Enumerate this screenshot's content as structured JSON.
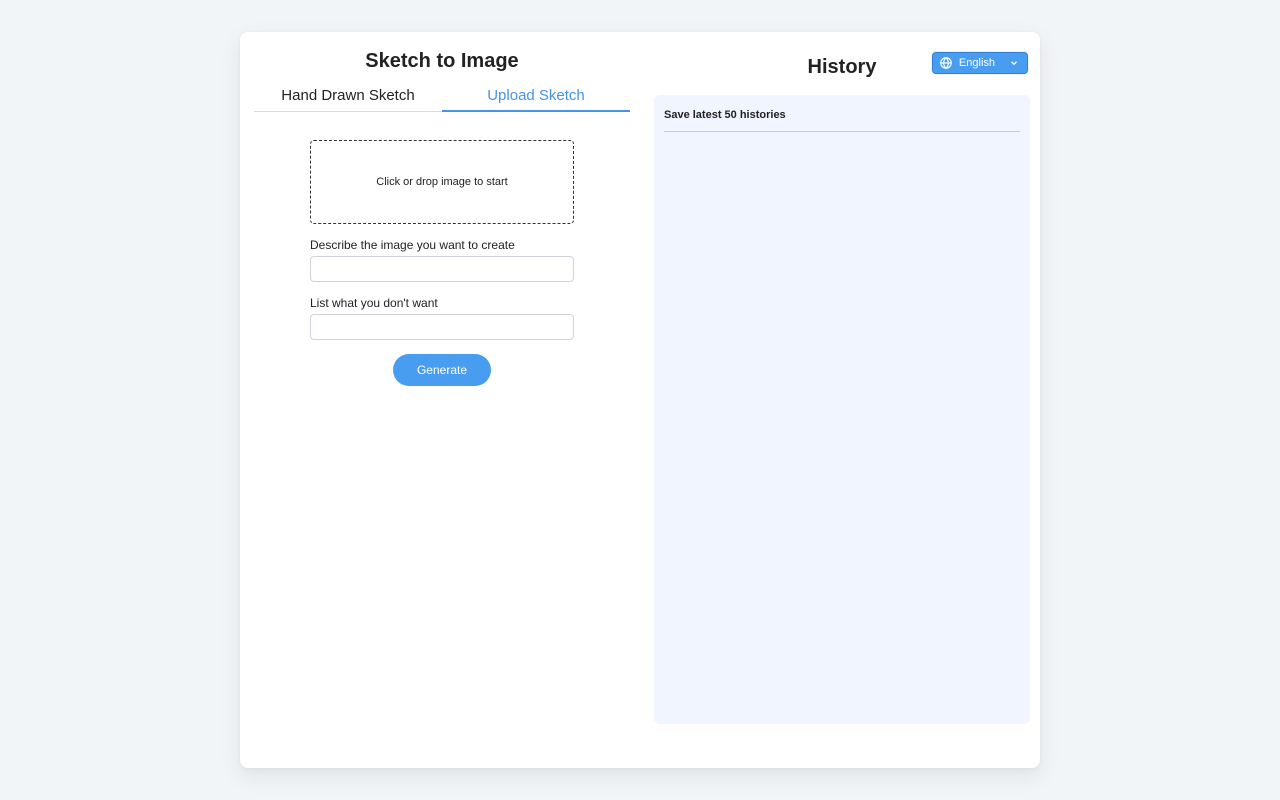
{
  "left": {
    "title": "Sketch to Image",
    "tabs": [
      {
        "label": "Hand Drawn Sketch"
      },
      {
        "label": "Upload Sketch"
      }
    ],
    "dropzone_text": "Click or drop image to start",
    "describe_label": "Describe the image you want to create",
    "negative_label": "List what you don't want",
    "generate_label": "Generate"
  },
  "right": {
    "title": "History",
    "history_note": "Save latest 50 histories"
  },
  "lang": {
    "label": "English"
  }
}
